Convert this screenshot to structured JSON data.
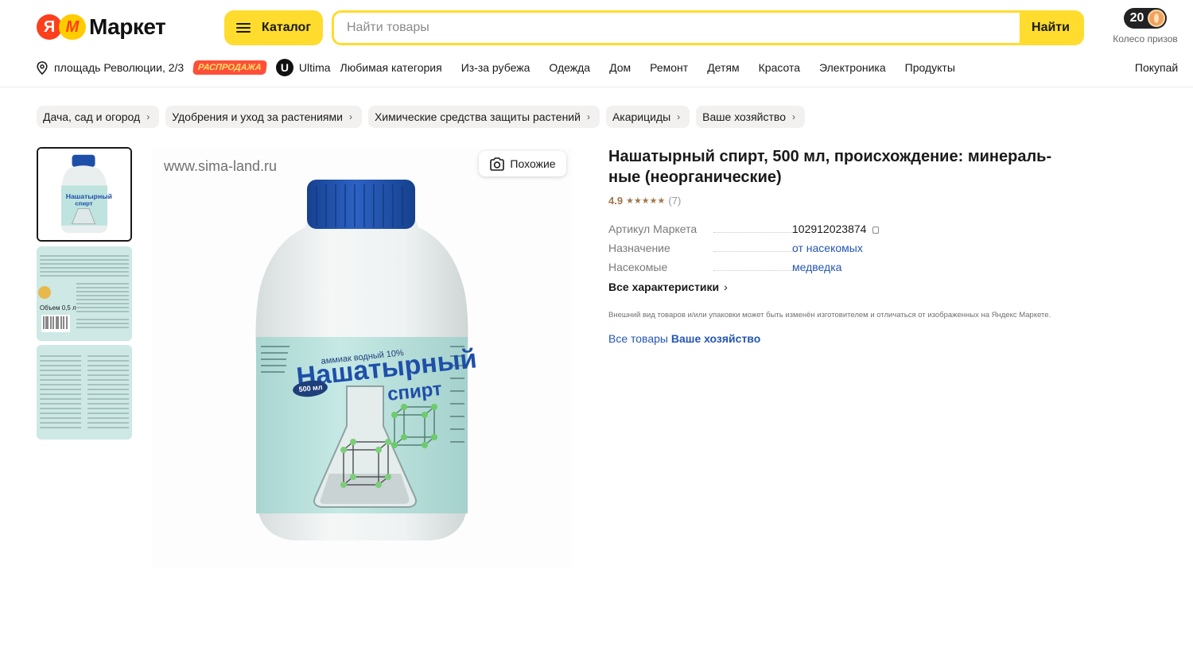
{
  "header": {
    "logo_ya": "Я",
    "logo_m": "M",
    "logo_text": "Маркет",
    "catalog_label": "Каталог",
    "search_placeholder": "Найти товары",
    "search_button": "Найти",
    "wheel_count": "20",
    "wheel_label": "Колесо призов"
  },
  "nav": {
    "location": "площадь Революции, 2/3",
    "sale_badge": "РАСПРОДАЖА",
    "ultima_label": "Ultima",
    "items": [
      "Любимая категория",
      "Из-за рубежа",
      "Одежда",
      "Дом",
      "Ремонт",
      "Детям",
      "Красота",
      "Электроника",
      "Продукты",
      "Покупай"
    ]
  },
  "breadcrumbs": [
    "Дача, сад и огород",
    "Удобрения и уход за растениями",
    "Химические средства защиты растений",
    "Акарициды",
    "Ваше хозяйство"
  ],
  "gallery": {
    "watermark": "www.sima-land.ru",
    "similar_button": "Похожие",
    "label_small": "аммиак водный 10%",
    "label_big_1": "Нашатырный",
    "label_big_2": "спирт",
    "label_volume": "500 мл",
    "thumb2_volume": "Объем 0,5 л"
  },
  "product": {
    "title": "Нашатырный спирт, 500 мл, происхождение: минераль-ные (неорганические)",
    "rating": "4.9",
    "stars": "★★★★★",
    "reviews": "(7)",
    "specs": [
      {
        "key": "Артикул Маркета",
        "value": "102912023874"
      },
      {
        "key": "Назначение",
        "value": "от насекомых"
      },
      {
        "key": "Насекомые",
        "value": "медведка"
      }
    ],
    "all_specs": "Все характеристики",
    "all_specs_arrow": "›",
    "disclaimer": "Внешний вид товаров и/или упаковки может быть изменён изготовителем и отличаться от изображенных на Яндекс Маркете.",
    "vendor_prefix": "Все товары",
    "vendor_name": "Ваше хозяйство"
  },
  "colors": {
    "accent_yellow": "#ffdc2d",
    "brand_red": "#fc3f1d",
    "link_blue": "#2456b4",
    "rating_brown": "#a0784a",
    "cap_blue": "#1e4fa8",
    "label_teal": "#bfe3df"
  }
}
